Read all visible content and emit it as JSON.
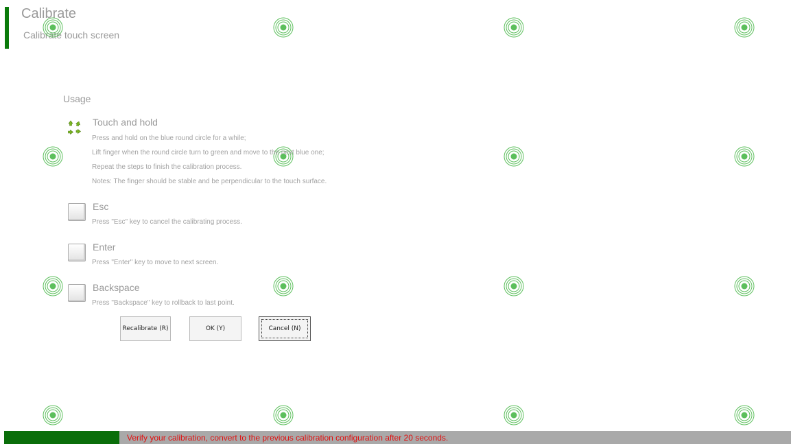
{
  "header": {
    "title": "Calibrate",
    "subtitle": "Calibrate touch screen"
  },
  "usage": {
    "heading": "Usage",
    "sections": [
      {
        "title": "Touch and hold",
        "icon": "arrows-icon",
        "lines": [
          "Press and hold on the blue round circle for a while;",
          "Lift finger when the round circle turn to green and move to the next blue one;",
          "Repeat the steps to finish the calibration process.",
          "Notes: The finger should be stable and be perpendicular to the touch surface."
        ]
      },
      {
        "title": "Esc",
        "icon": "key-icon",
        "lines": [
          "Press \"Esc\" key to cancel the calibrating process."
        ]
      },
      {
        "title": "Enter",
        "icon": "key-icon",
        "lines": [
          "Press \"Enter\" key to move to next screen."
        ]
      },
      {
        "title": "Backspace",
        "icon": "key-icon",
        "lines": [
          "Press \"Backspace\" key to rollback to last point."
        ]
      }
    ]
  },
  "buttons": {
    "recalibrate": "Recalibrate (R)",
    "ok": "OK (Y)",
    "cancel": "Cancel (N)"
  },
  "status": {
    "message": "Verify your calibration, convert to the previous calibration configuration after 20 seconds."
  },
  "calibration_points": {
    "count": 16,
    "state": "completed",
    "icon": "target-circle-icon"
  },
  "colors": {
    "accent_green": "#0a7a0a",
    "target_green": "#5cbf5c",
    "status_gray": "#a9a9a9",
    "status_text_red": "#e01010"
  }
}
